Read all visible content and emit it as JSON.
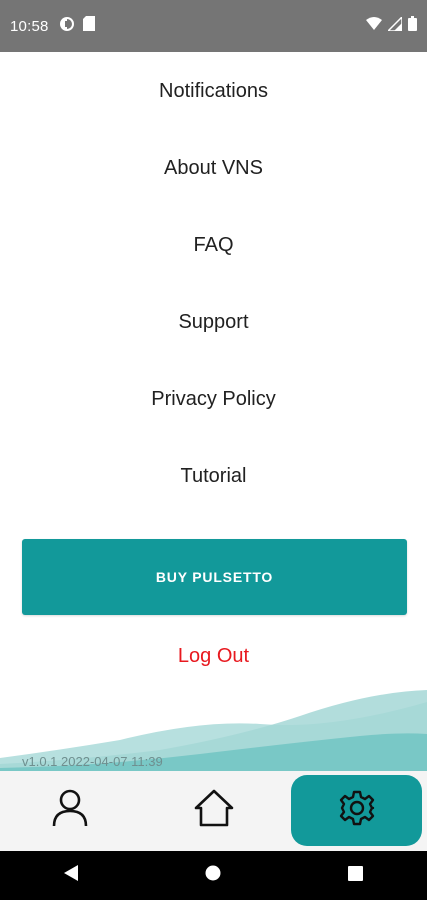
{
  "status_bar": {
    "time": "10:58",
    "left_icons": [
      "pulse-app-icon",
      "sd-card-icon"
    ],
    "right_icons": [
      "wifi-icon",
      "cell-signal-icon",
      "battery-icon"
    ]
  },
  "menu": {
    "items": [
      {
        "label": "Notifications"
      },
      {
        "label": "About VNS"
      },
      {
        "label": "FAQ"
      },
      {
        "label": "Support"
      },
      {
        "label": "Privacy Policy"
      },
      {
        "label": "Tutorial"
      }
    ]
  },
  "buy_button": {
    "label": "BUY PULSETTO"
  },
  "logout": {
    "label": "Log Out"
  },
  "version": "v1.0.1 2022-04-07 11:39",
  "tabs": [
    {
      "icon": "person-icon",
      "active": false
    },
    {
      "icon": "home-icon",
      "active": false
    },
    {
      "icon": "gear-icon",
      "active": true
    }
  ],
  "nav_bar": [
    "back-icon",
    "home-circle-icon",
    "recents-icon"
  ],
  "colors": {
    "accent": "#12999a",
    "logout": "#e8191f",
    "status_bar": "#757575",
    "tab_bar": "#f4f4f4"
  }
}
